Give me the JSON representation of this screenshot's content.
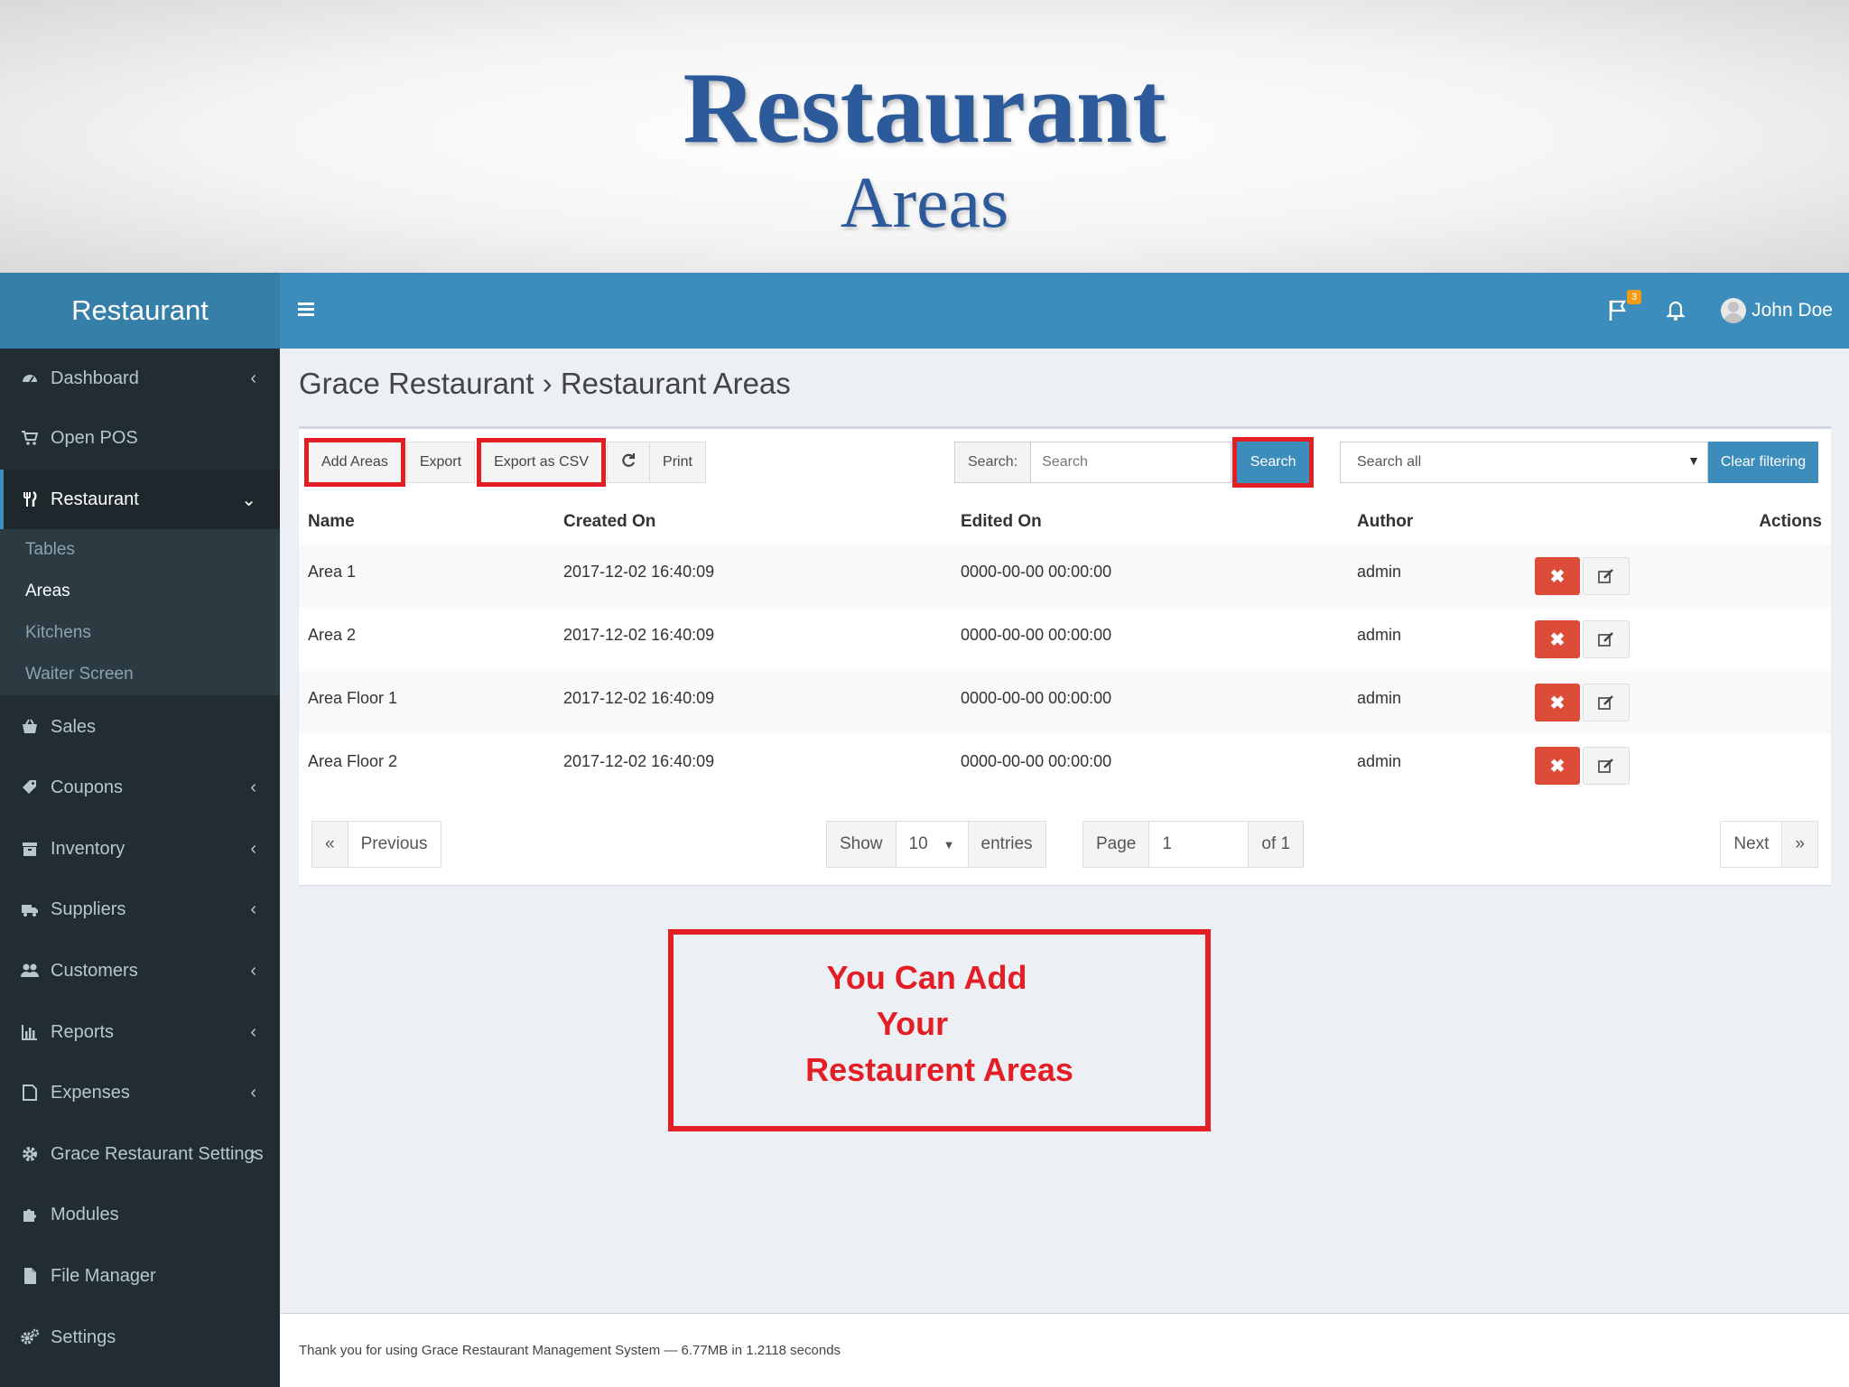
{
  "slide": {
    "title": "Restaurant",
    "subtitle": "Areas"
  },
  "brand": "Restaurant",
  "topbar": {
    "flag_badge": "3",
    "user_name": "John Doe"
  },
  "sidebar": {
    "items": [
      {
        "label": "Dashboard",
        "icon": "dashboard-icon",
        "has_chevron": true
      },
      {
        "label": "Open POS",
        "icon": "cart-icon",
        "has_chevron": false
      },
      {
        "label": "Restaurant",
        "icon": "cutlery-icon",
        "expanded": true
      },
      {
        "label": "Sales",
        "icon": "basket-icon",
        "has_chevron": false
      },
      {
        "label": "Coupons",
        "icon": "tag-icon",
        "has_chevron": true
      },
      {
        "label": "Inventory",
        "icon": "archive-icon",
        "has_chevron": true
      },
      {
        "label": "Suppliers",
        "icon": "truck-icon",
        "has_chevron": true
      },
      {
        "label": "Customers",
        "icon": "users-icon",
        "has_chevron": true
      },
      {
        "label": "Reports",
        "icon": "bar-chart-icon",
        "has_chevron": true
      },
      {
        "label": "Expenses",
        "icon": "note-icon",
        "has_chevron": true
      },
      {
        "label": "Grace Restaurant Settings",
        "icon": "cog-icon",
        "has_chevron": true
      },
      {
        "label": "Modules",
        "icon": "puzzle-icon",
        "has_chevron": false
      },
      {
        "label": "File Manager",
        "icon": "file-icon",
        "has_chevron": false
      },
      {
        "label": "Settings",
        "icon": "cogs-icon",
        "has_chevron": false
      }
    ],
    "submenu": [
      "Tables",
      "Areas",
      "Kitchens",
      "Waiter Screen"
    ],
    "submenu_current": "Areas"
  },
  "breadcrumb": {
    "parent": "Grace Restaurant",
    "separator": "›",
    "current": "Restaurant Areas"
  },
  "toolbar": {
    "add_label": "Add Areas",
    "export_label": "Export",
    "export_csv_label": "Export as CSV",
    "refresh_icon": "refresh-icon",
    "print_label": "Print",
    "search_label": "Search:",
    "search_placeholder": "Search",
    "search_button": "Search",
    "filter_select": "Search all",
    "clear_button": "Clear filtering"
  },
  "table": {
    "columns": [
      "Name",
      "Created On",
      "Edited On",
      "Author",
      "Actions"
    ],
    "rows": [
      {
        "name": "Area 1",
        "created": "2017-12-02 16:40:09",
        "edited": "0000-00-00 00:00:00",
        "author": "admin"
      },
      {
        "name": "Area 2",
        "created": "2017-12-02 16:40:09",
        "edited": "0000-00-00 00:00:00",
        "author": "admin"
      },
      {
        "name": "Area Floor 1",
        "created": "2017-12-02 16:40:09",
        "edited": "0000-00-00 00:00:00",
        "author": "admin"
      },
      {
        "name": "Area Floor 2",
        "created": "2017-12-02 16:40:09",
        "edited": "0000-00-00 00:00:00",
        "author": "admin"
      }
    ]
  },
  "pager": {
    "first": "«",
    "previous": "Previous",
    "show": "Show",
    "per_page": "10",
    "entries": "entries",
    "page_label": "Page",
    "page_value": "1",
    "of": "of 1",
    "next": "Next",
    "last": "»"
  },
  "callout": {
    "line1": "You Can Add",
    "line2": "Your",
    "line3": "Restaurent Areas"
  },
  "footer": "Thank you for using Grace Restaurant Management System — 6.77MB in 1.2118 seconds",
  "colors": {
    "primary": "#3c8dbc",
    "brand": "#367fa9",
    "sidebar": "#222d32",
    "danger": "#dd4b39",
    "highlight": "#e31e24",
    "slide_title": "#2d5a9a"
  }
}
